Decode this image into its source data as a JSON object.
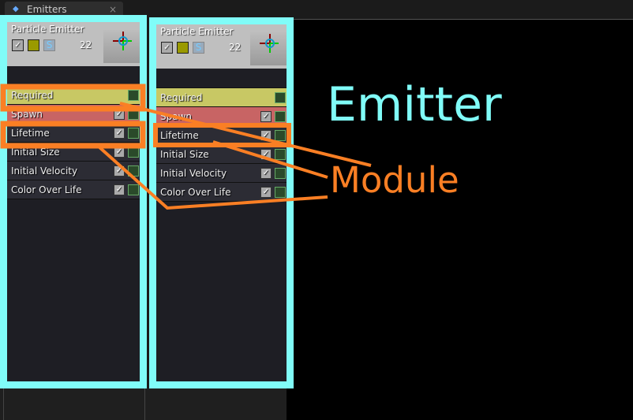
{
  "tab": {
    "title": "Emitters",
    "close": "×"
  },
  "emitters": [
    {
      "title": "Particle Emitter",
      "count": "22",
      "solo": "S"
    },
    {
      "title": "Particle Emitter",
      "count": "22",
      "solo": "S"
    }
  ],
  "modules": [
    "Required",
    "Spawn",
    "Lifetime",
    "Initial Size",
    "Initial Velocity",
    "Color Over Life"
  ],
  "annotations": {
    "emitter": "Emitter",
    "module": "Module",
    "colors": {
      "emitter": "#80fcf8",
      "module": "#fa7f24"
    }
  }
}
